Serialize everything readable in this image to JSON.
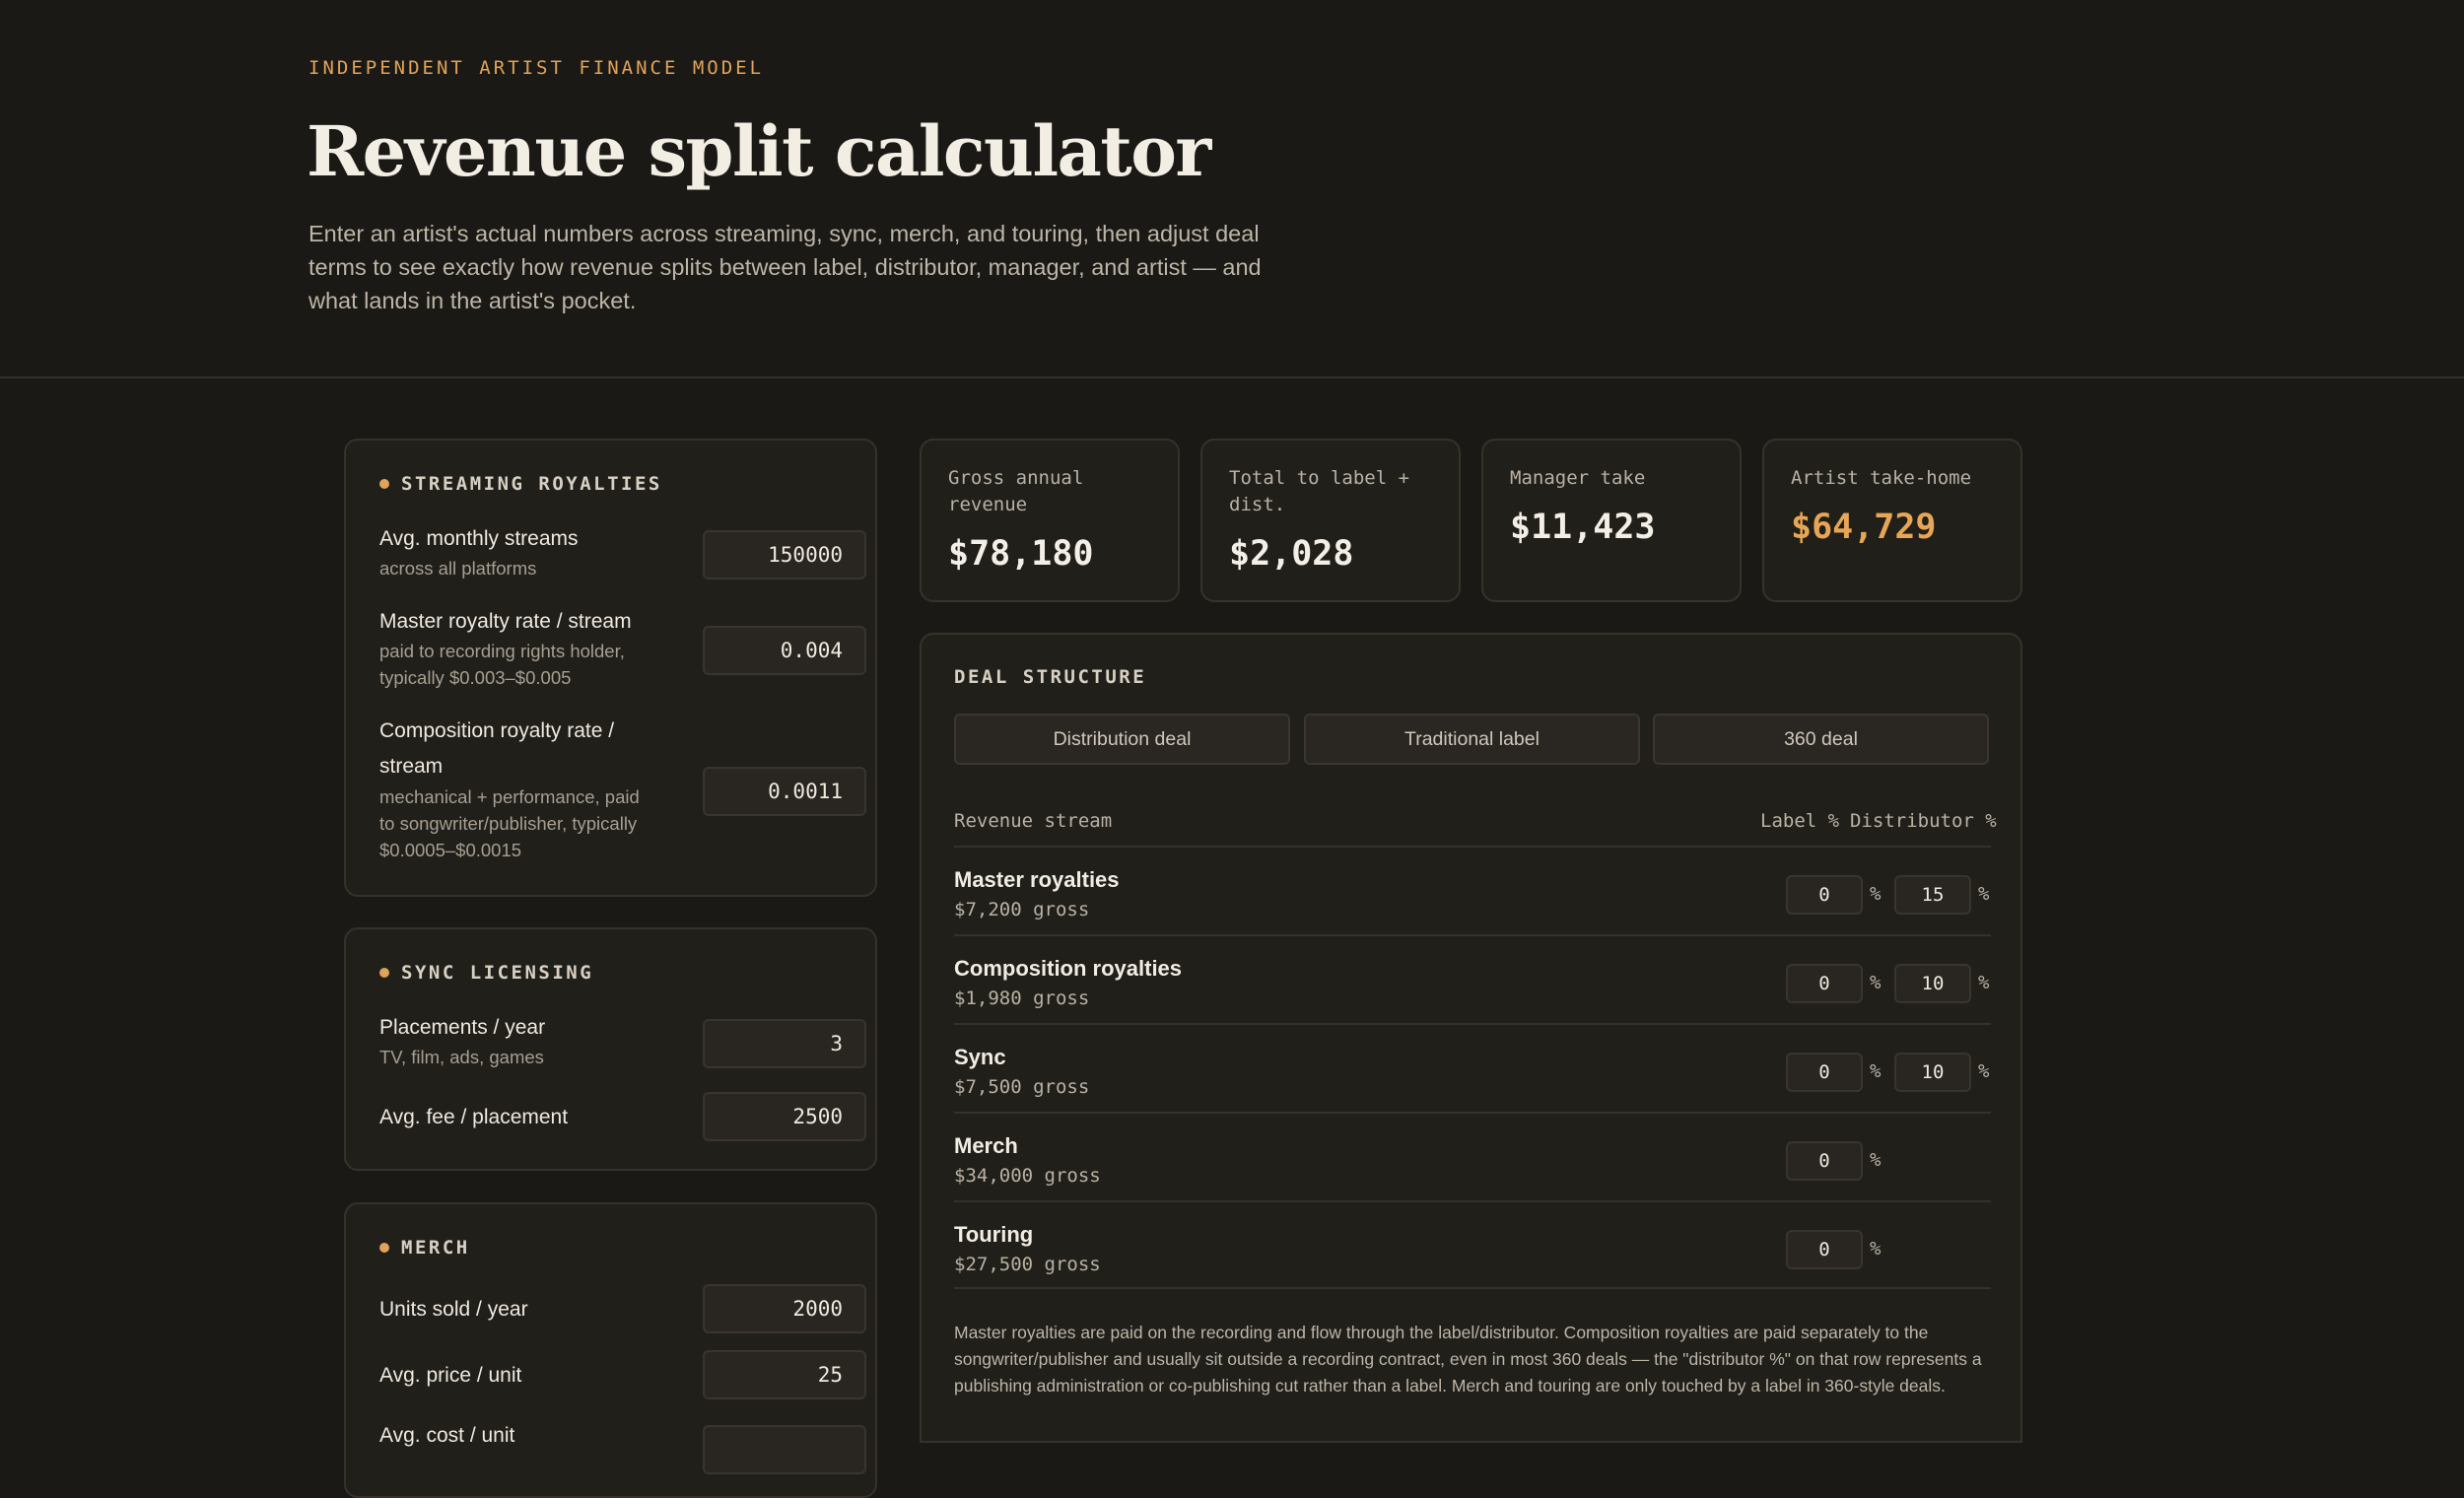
{
  "header": {
    "eyebrow": "INDEPENDENT ARTIST FINANCE MODEL",
    "title": "Revenue split calculator",
    "intro": "Enter an artist's actual numbers across streaming, sync, merch, and touring, then adjust deal terms to see exactly how revenue splits between label, distributor, manager, and artist — and what lands in the artist's pocket."
  },
  "streaming": {
    "title": "STREAMING ROYALTIES",
    "fields": [
      {
        "label": "Avg. monthly streams",
        "hint": "across all platforms",
        "value": "150000"
      },
      {
        "label": "Master royalty rate / stream",
        "hint_lines": [
          "paid to recording rights holder,",
          "typically $0.003–$0.005"
        ],
        "value": "0.004"
      },
      {
        "label_lines": [
          "Composition royalty rate /",
          "stream"
        ],
        "hint_lines": [
          "mechanical + performance, paid",
          "to songwriter/publisher, typically",
          "$0.0005–$0.0015"
        ],
        "value": "0.0011"
      }
    ]
  },
  "sync": {
    "title": "SYNC LICENSING",
    "fields": [
      {
        "label": "Placements / year",
        "hint": "TV, film, ads, games",
        "value": "3"
      },
      {
        "label": "Avg. fee / placement",
        "value": "2500"
      }
    ]
  },
  "merch": {
    "title": "MERCH",
    "fields": [
      {
        "label": "Units sold / year",
        "value": "2000"
      },
      {
        "label": "Avg. price / unit",
        "value": "25"
      },
      {
        "label": "Avg. cost / unit",
        "value": ""
      }
    ]
  },
  "metrics": [
    {
      "label": "Gross annual revenue",
      "value": "$78,180"
    },
    {
      "label": "Total to label + dist.",
      "value": "$2,028"
    },
    {
      "label": "Manager take",
      "value": "$11,423"
    },
    {
      "label": "Artist take-home",
      "value": "$64,729"
    }
  ],
  "deal": {
    "title": "DEAL STRUCTURE",
    "tabs": [
      "Distribution deal",
      "Traditional label",
      "360 deal"
    ],
    "col_stream": "Revenue stream",
    "col_label": "Label %",
    "col_dist": "Distributor %",
    "pct_sign": "%",
    "rows": [
      {
        "name": "Master royalties",
        "gross": "$7,200 gross",
        "label": "0",
        "dist": "15"
      },
      {
        "name": "Composition royalties",
        "gross": "$1,980 gross",
        "label": "0",
        "dist": "10"
      },
      {
        "name": "Sync",
        "gross": "$7,500 gross",
        "label": "0",
        "dist": "10"
      },
      {
        "name": "Merch",
        "gross": "$34,000 gross",
        "label": "0"
      },
      {
        "name": "Touring",
        "gross": "$27,500 gross",
        "label": "0"
      }
    ],
    "note": "Master royalties are paid on the recording and flow through the label/distributor. Composition royalties are paid separately to the songwriter/publisher and usually sit outside a recording contract, even in most 360 deals — the \"distributor %\" on that row represents a publishing administration or co-publishing cut rather than a label. Merch and touring are only touched by a label in 360-style deals."
  },
  "colors": {
    "accent": "#e0a35a",
    "background": "#1b1915",
    "card": "#211f1a"
  }
}
